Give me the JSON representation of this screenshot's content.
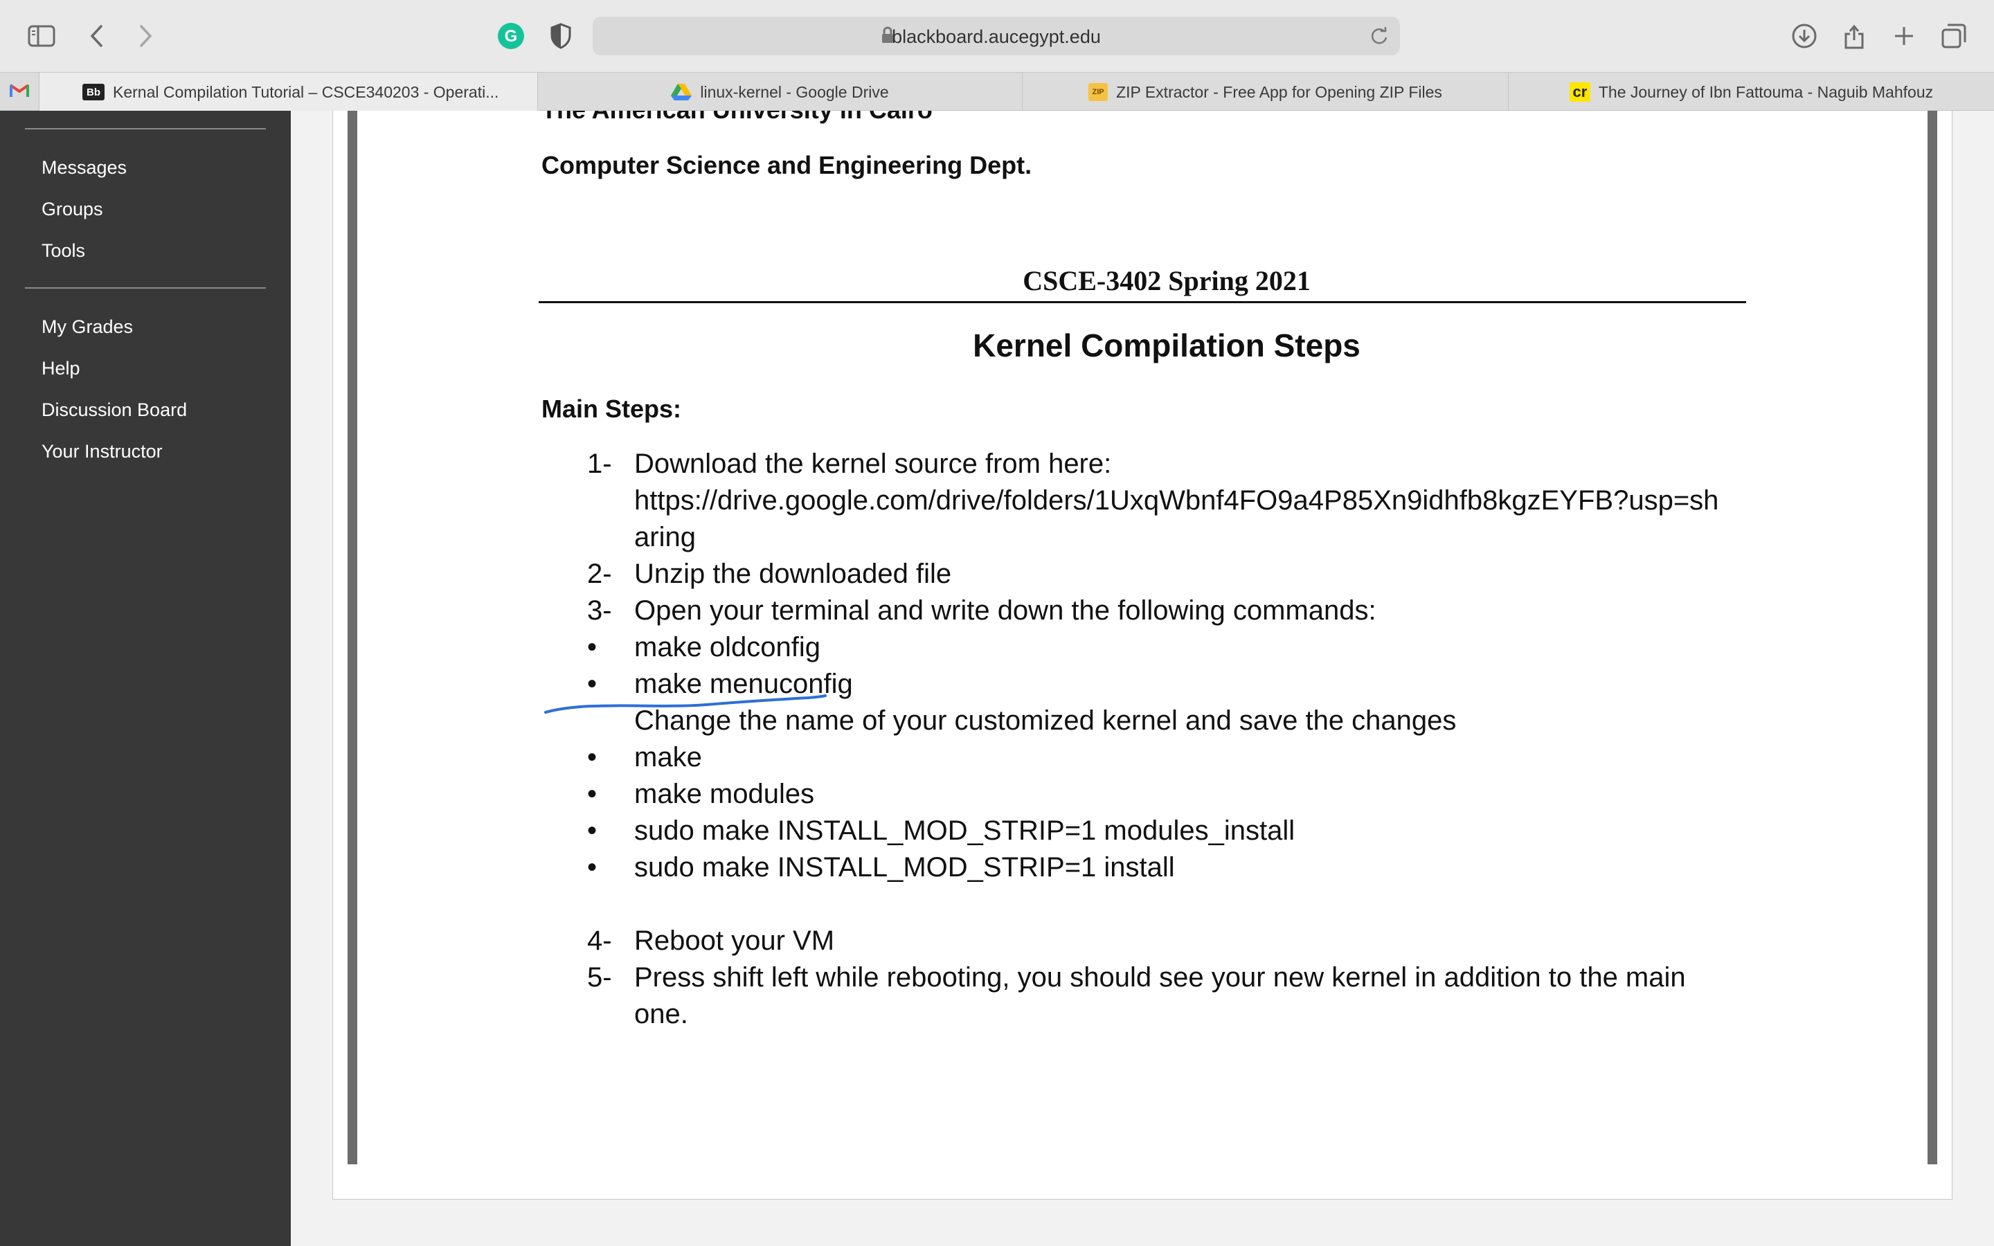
{
  "browser": {
    "url": "blackboard.aucegypt.edu"
  },
  "tabs": [
    {
      "favicon": "gmail-icon",
      "label": ""
    },
    {
      "favicon": "blackboard-icon",
      "fav_text": "Bb",
      "label": "Kernal Compilation Tutorial – CSCE340203 - Operati..."
    },
    {
      "favicon": "google-drive-icon",
      "label": "linux-kernel - Google Drive"
    },
    {
      "favicon": "zip-icon",
      "fav_text": "ZIP",
      "label": "ZIP Extractor - Free App for Opening ZIP Files"
    },
    {
      "favicon": "cr-icon",
      "fav_text": "cr",
      "label": "The Journey of Ibn Fattouma - Naguib Mahfouz"
    }
  ],
  "sidebar": {
    "group1": [
      "Messages",
      "Groups",
      "Tools"
    ],
    "group2": [
      "My Grades",
      "Help",
      "Discussion Board",
      "Your Instructor"
    ]
  },
  "document": {
    "university": "The American University in Cairo",
    "department": "Computer Science and Engineering Dept.",
    "course": "CSCE-3402 Spring 2021",
    "title": "Kernel Compilation Steps",
    "main_steps_label": "Main Steps:",
    "steps": {
      "s1_num": "1-",
      "s1_text": "Download the kernel source from here:",
      "s1_url_line1": "https://drive.google.com/drive/folders/1UxqWbnf4FO9a4P85Xn9idhfb8kgzEYFB?usp=sh",
      "s1_url_line2": "aring",
      "s2_num": "2-",
      "s2_text": "Unzip the downloaded file",
      "s3_num": "3-",
      "s3_text": "Open your terminal and write down the following commands:",
      "cmd1": "make oldconfig",
      "cmd2": "make menuconfig",
      "cmd2_note": "Change the name of your customized kernel and save the changes",
      "cmd3": "make",
      "cmd4": "make modules",
      "cmd5": "sudo make INSTALL_MOD_STRIP=1 modules_install",
      "cmd6": "sudo make INSTALL_MOD_STRIP=1 install",
      "s4_num": "4-",
      "s4_text": "Reboot your VM",
      "s5_num": "5-",
      "s5_text_line1": "Press shift left while rebooting, you should see your new kernel in addition to the main",
      "s5_text_line2": "one.",
      "bullet": "•"
    }
  },
  "colors": {
    "sidebar_bg": "#383838",
    "annotation_ink": "#2f6fd6",
    "grammarly": "#15c39a"
  }
}
